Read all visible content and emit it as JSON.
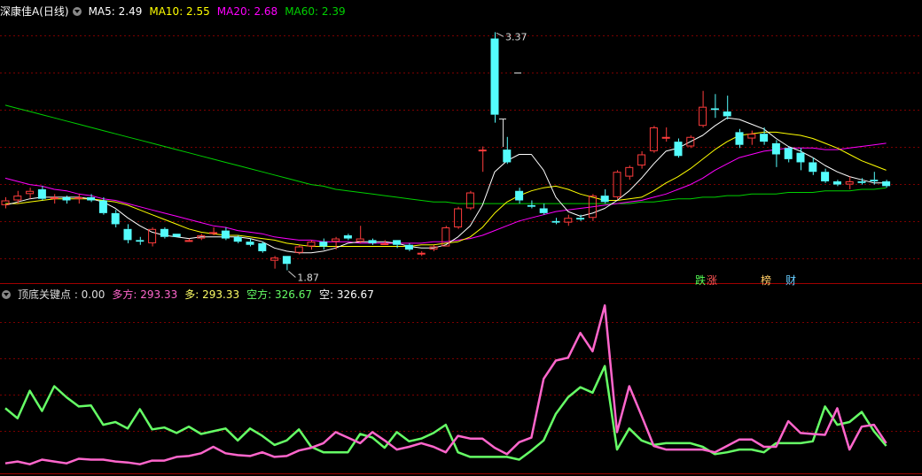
{
  "main_header": {
    "title": "深康佳A(日线)",
    "ma5": "MA5: 2.49",
    "ma10": "MA10: 2.55",
    "ma20": "MA20: 2.68",
    "ma60": "MA60: 2.39"
  },
  "sub_header": {
    "title": "顶底关键点 : 0.00",
    "duofang": "多方: 293.33",
    "duo": "多: 293.33",
    "kongfang": "空方: 326.67",
    "kong": "空: 326.67"
  },
  "labels": {
    "high": "3.37",
    "low": "1.87",
    "tag_die": "跌",
    "tag_zhang": "涨",
    "tag_bang": "榜",
    "tag_cai": "财"
  },
  "colors": {
    "up": "#ff3c3c",
    "down": "#54fcfc",
    "ma5": "#ffffff",
    "ma10": "#ffff00",
    "ma20": "#ff00ff",
    "ma60": "#00d000",
    "duofang": "#ff66cc",
    "kongfang": "#66ff66",
    "grid": "#7a0000"
  },
  "chart_data": [
    {
      "type": "candlestick",
      "price_range": [
        1.8,
        3.45
      ],
      "candles": [
        [
          2.28,
          2.33,
          2.26,
          2.31
        ],
        [
          2.31,
          2.37,
          2.29,
          2.34
        ],
        [
          2.35,
          2.39,
          2.32,
          2.37
        ],
        [
          2.38,
          2.4,
          2.31,
          2.32
        ],
        [
          2.33,
          2.35,
          2.29,
          2.33
        ],
        [
          2.33,
          2.34,
          2.29,
          2.31
        ],
        [
          2.32,
          2.35,
          2.29,
          2.33
        ],
        [
          2.33,
          2.35,
          2.3,
          2.31
        ],
        [
          2.31,
          2.33,
          2.22,
          2.23
        ],
        [
          2.23,
          2.25,
          2.14,
          2.16
        ],
        [
          2.13,
          2.16,
          2.04,
          2.06
        ],
        [
          2.06,
          2.08,
          2.03,
          2.05
        ],
        [
          2.04,
          2.14,
          2.02,
          2.13
        ],
        [
          2.13,
          2.14,
          2.07,
          2.08
        ],
        [
          2.1,
          2.1,
          2.08,
          2.08
        ],
        [
          2.06,
          2.07,
          2.05,
          2.06
        ],
        [
          2.07,
          2.1,
          2.06,
          2.09
        ],
        [
          2.1,
          2.14,
          2.09,
          2.11
        ],
        [
          2.12,
          2.14,
          2.06,
          2.07
        ],
        [
          2.08,
          2.09,
          2.04,
          2.05
        ],
        [
          2.05,
          2.07,
          2.02,
          2.03
        ],
        [
          2.04,
          2.05,
          1.98,
          1.99
        ],
        [
          1.93,
          1.96,
          1.88,
          1.95
        ],
        [
          1.96,
          1.96,
          1.87,
          1.91
        ],
        [
          1.98,
          2.03,
          1.97,
          2.02
        ],
        [
          2.02,
          2.06,
          2.0,
          2.05
        ],
        [
          2.05,
          2.07,
          2.0,
          2.02
        ],
        [
          2.05,
          2.08,
          2.0,
          2.07
        ],
        [
          2.09,
          2.1,
          2.06,
          2.07
        ],
        [
          2.05,
          2.15,
          2.04,
          2.07
        ],
        [
          2.06,
          2.07,
          2.03,
          2.04
        ],
        [
          2.04,
          2.06,
          2.03,
          2.04
        ],
        [
          2.06,
          2.06,
          2.01,
          2.03
        ],
        [
          2.03,
          2.04,
          1.99,
          2.0
        ],
        [
          1.97,
          1.99,
          1.96,
          1.98
        ],
        [
          2.0,
          2.03,
          1.99,
          2.02
        ],
        [
          2.02,
          2.15,
          2.02,
          2.14
        ],
        [
          2.14,
          2.27,
          2.13,
          2.26
        ],
        [
          2.26,
          2.37,
          2.25,
          2.36
        ],
        [
          2.63,
          2.65,
          2.49,
          2.63
        ],
        [
          3.33,
          3.37,
          2.8,
          2.85
        ],
        [
          2.63,
          2.71,
          2.54,
          2.55
        ],
        [
          2.37,
          2.39,
          2.29,
          2.31
        ],
        [
          2.28,
          2.31,
          2.26,
          2.27
        ],
        [
          2.26,
          2.29,
          2.22,
          2.23
        ],
        [
          2.18,
          2.2,
          2.16,
          2.17
        ],
        [
          2.17,
          2.22,
          2.15,
          2.2
        ],
        [
          2.2,
          2.22,
          2.18,
          2.19
        ],
        [
          2.2,
          2.35,
          2.18,
          2.34
        ],
        [
          2.34,
          2.38,
          2.29,
          2.3
        ],
        [
          2.33,
          2.5,
          2.32,
          2.49
        ],
        [
          2.46,
          2.53,
          2.44,
          2.52
        ],
        [
          2.53,
          2.62,
          2.51,
          2.6
        ],
        [
          2.62,
          2.78,
          2.61,
          2.77
        ],
        [
          2.71,
          2.77,
          2.68,
          2.71
        ],
        [
          2.68,
          2.7,
          2.58,
          2.59
        ],
        [
          2.65,
          2.72,
          2.64,
          2.71
        ],
        [
          2.78,
          3.0,
          2.77,
          2.9
        ],
        [
          2.89,
          2.98,
          2.83,
          2.88
        ],
        [
          2.87,
          2.97,
          2.82,
          2.84
        ],
        [
          2.74,
          2.76,
          2.64,
          2.66
        ],
        [
          2.7,
          2.75,
          2.66,
          2.73
        ],
        [
          2.73,
          2.77,
          2.66,
          2.68
        ],
        [
          2.67,
          2.69,
          2.52,
          2.6
        ],
        [
          2.64,
          2.65,
          2.55,
          2.57
        ],
        [
          2.61,
          2.64,
          2.5,
          2.55
        ],
        [
          2.55,
          2.58,
          2.47,
          2.49
        ],
        [
          2.49,
          2.51,
          2.42,
          2.43
        ],
        [
          2.43,
          2.44,
          2.4,
          2.41
        ],
        [
          2.41,
          2.46,
          2.38,
          2.43
        ],
        [
          2.43,
          2.45,
          2.41,
          2.42
        ],
        [
          2.44,
          2.49,
          2.41,
          2.43
        ],
        [
          2.43,
          2.44,
          2.39,
          2.4
        ]
      ],
      "ma5": [
        2.28,
        2.3,
        2.32,
        2.33,
        2.33,
        2.33,
        2.33,
        2.32,
        2.3,
        2.26,
        2.2,
        2.15,
        2.11,
        2.09,
        2.08,
        2.07,
        2.08,
        2.08,
        2.08,
        2.08,
        2.07,
        2.05,
        2.01,
        1.99,
        1.98,
        1.98,
        1.99,
        2.01,
        2.04,
        2.05,
        2.05,
        2.05,
        2.04,
        2.02,
        2.01,
        2.01,
        2.03,
        2.08,
        2.15,
        2.28,
        2.49,
        2.56,
        2.6,
        2.6,
        2.5,
        2.33,
        2.24,
        2.21,
        2.23,
        2.26,
        2.31,
        2.37,
        2.45,
        2.54,
        2.62,
        2.64,
        2.68,
        2.72,
        2.78,
        2.83,
        2.82,
        2.79,
        2.76,
        2.7,
        2.65,
        2.62,
        2.58,
        2.53,
        2.49,
        2.46,
        2.44,
        2.42,
        2.42
      ],
      "ma10": [
        2.29,
        2.29,
        2.3,
        2.31,
        2.32,
        2.32,
        2.32,
        2.32,
        2.31,
        2.3,
        2.28,
        2.25,
        2.22,
        2.19,
        2.16,
        2.13,
        2.11,
        2.1,
        2.09,
        2.09,
        2.08,
        2.07,
        2.06,
        2.04,
        2.03,
        2.02,
        2.02,
        2.02,
        2.02,
        2.02,
        2.02,
        2.02,
        2.02,
        2.02,
        2.03,
        2.03,
        2.04,
        2.05,
        2.08,
        2.14,
        2.23,
        2.3,
        2.34,
        2.37,
        2.39,
        2.4,
        2.38,
        2.35,
        2.33,
        2.31,
        2.31,
        2.32,
        2.33,
        2.37,
        2.42,
        2.46,
        2.51,
        2.57,
        2.63,
        2.68,
        2.72,
        2.73,
        2.74,
        2.74,
        2.73,
        2.72,
        2.7,
        2.67,
        2.64,
        2.6,
        2.56,
        2.53,
        2.5
      ],
      "ma20": [
        2.45,
        2.43,
        2.41,
        2.4,
        2.38,
        2.37,
        2.35,
        2.34,
        2.32,
        2.31,
        2.29,
        2.27,
        2.25,
        2.23,
        2.21,
        2.19,
        2.17,
        2.15,
        2.14,
        2.12,
        2.11,
        2.1,
        2.08,
        2.07,
        2.06,
        2.06,
        2.05,
        2.05,
        2.05,
        2.04,
        2.04,
        2.04,
        2.04,
        2.04,
        2.04,
        2.05,
        2.05,
        2.06,
        2.07,
        2.09,
        2.12,
        2.15,
        2.18,
        2.2,
        2.22,
        2.24,
        2.25,
        2.26,
        2.27,
        2.28,
        2.29,
        2.3,
        2.31,
        2.33,
        2.35,
        2.38,
        2.41,
        2.45,
        2.5,
        2.54,
        2.58,
        2.6,
        2.62,
        2.63,
        2.64,
        2.64,
        2.64,
        2.63,
        2.63,
        2.64,
        2.65,
        2.66,
        2.67
      ],
      "ma60": [
        2.91,
        2.89,
        2.87,
        2.85,
        2.83,
        2.81,
        2.79,
        2.77,
        2.75,
        2.73,
        2.71,
        2.69,
        2.67,
        2.65,
        2.63,
        2.61,
        2.59,
        2.57,
        2.55,
        2.53,
        2.51,
        2.49,
        2.47,
        2.45,
        2.43,
        2.41,
        2.4,
        2.38,
        2.37,
        2.36,
        2.35,
        2.34,
        2.33,
        2.32,
        2.31,
        2.3,
        2.3,
        2.29,
        2.29,
        2.29,
        2.29,
        2.29,
        2.29,
        2.29,
        2.29,
        2.29,
        2.29,
        2.29,
        2.29,
        2.29,
        2.29,
        2.29,
        2.3,
        2.3,
        2.31,
        2.32,
        2.32,
        2.33,
        2.33,
        2.34,
        2.34,
        2.35,
        2.35,
        2.35,
        2.36,
        2.36,
        2.36,
        2.37,
        2.37,
        2.37,
        2.38,
        2.38,
        2.39
      ]
    },
    {
      "type": "line",
      "title": "顶底关键点",
      "y_range": [
        0,
        1850
      ],
      "series": [
        {
          "name": "多方",
          "values": [
            80,
            100,
            70,
            120,
            100,
            80,
            130,
            120,
            120,
            100,
            90,
            70,
            110,
            110,
            150,
            160,
            190,
            260,
            190,
            170,
            160,
            200,
            150,
            160,
            220,
            250,
            300,
            420,
            360,
            300,
            420,
            330,
            230,
            260,
            300,
            260,
            200,
            380,
            350,
            350,
            250,
            180,
            310,
            360,
            1000,
            1200,
            1230,
            1500,
            1300,
            1800,
            420,
            920,
            600,
            270,
            230,
            230,
            230,
            230,
            200,
            270,
            340,
            340,
            260,
            260,
            540,
            410,
            400,
            390,
            680,
            230,
            480,
            500,
            300
          ]
        },
        {
          "name": "空方",
          "values": [
            680,
            570,
            870,
            650,
            920,
            800,
            700,
            710,
            500,
            530,
            460,
            670,
            450,
            470,
            410,
            480,
            400,
            430,
            460,
            330,
            460,
            380,
            280,
            330,
            450,
            260,
            200,
            200,
            200,
            400,
            360,
            250,
            420,
            320,
            350,
            410,
            500,
            200,
            150,
            150,
            150,
            150,
            120,
            220,
            330,
            620,
            800,
            910,
            850,
            1140,
            230,
            460,
            330,
            280,
            300,
            300,
            300,
            260,
            180,
            200,
            230,
            230,
            200,
            300,
            300,
            300,
            320,
            700,
            500,
            530,
            640,
            430,
            270
          ]
        }
      ]
    }
  ]
}
